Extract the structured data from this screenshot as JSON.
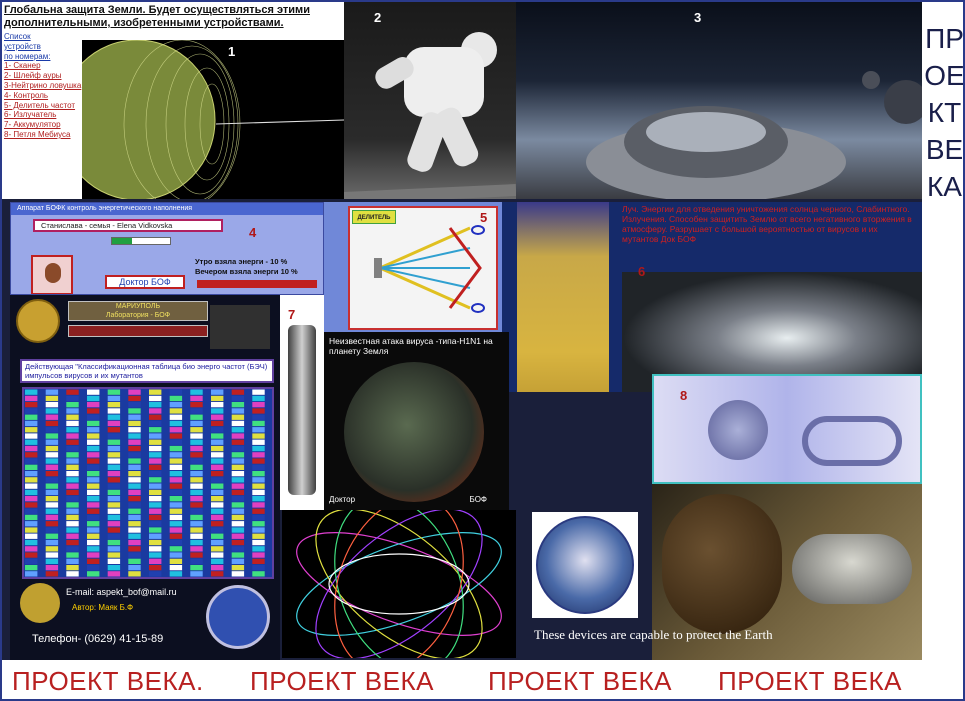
{
  "header": {
    "title": "Глобальна защита Земли. Будет осуществляться этими  дополнительными, изобретенными устройствами.",
    "list_heading": [
      "Список",
      "устройств",
      "по номерам:"
    ],
    "list_items": [
      "1- Сканер",
      "2- Шлейф ауры",
      "3-Нейтрино ловушка",
      "4- Контроль",
      "5- Делитель частот",
      "6- Излучатель",
      "7- Аккумулятор",
      "8- Петля Мебиуса"
    ]
  },
  "panel_numbers": {
    "n1": "1",
    "n2": "2",
    "n3": "3",
    "n4": "4",
    "n5": "5",
    "n6": "6",
    "n7": "7",
    "n8": "8"
  },
  "sidebar": {
    "text": "ПРОЕКТ ВЕКА"
  },
  "device4": {
    "window_title": "Аппарат БОФК контроль энергетического наполнения",
    "name_field": "Станислава - семья - Elena Vidkovska",
    "button": "Доктор БОФ",
    "morning": "Утро  взяла энерги - 10 %",
    "evening": "Вечером  взяла энерги 10 %"
  },
  "device5": {
    "label": "ДЕЛИТЕЛЬ"
  },
  "device6": {
    "text": "Луч. Энергии для отведения уничтожения солнца черного, Слабинтного. Излучения.  Способен защитить Землю от всего негативного вторжения в атмосферу. Разрушает с большой вероятностью  от вирусов и их мутантов Док БОФ"
  },
  "left_panel": {
    "badge_top": "МАРИУПОЛЬ",
    "badge_sub": "Лаборатория - БОФ",
    "table_title": "Действующая \"Классификационная таблица био энерго частот (БЭЧ) импульсов вирусов и их мутантов",
    "email": "E-mail: aspekt_bof@mail.ru",
    "author": "Автор: Маяк Б.Ф",
    "phone": "Телефон- (0629) 41-15-89"
  },
  "virus_panel": {
    "title": "Неизвестная атака вируса  -типа-H1N1 на планету Земля",
    "doctor": "Доктор",
    "bof": "БОФ"
  },
  "caption": "These devices are capable to protect the Earth",
  "footer": {
    "items": [
      "ПРОЕКТ ВЕКА.",
      "ПРОЕКТ ВЕКА",
      "ПРОЕКТ ВЕКА",
      "ПРОЕКТ ВЕКА"
    ]
  },
  "colors": {
    "footer_text": "#b82020",
    "sidebar_text": "#1a1f4a",
    "border": "#2a3a8a"
  }
}
